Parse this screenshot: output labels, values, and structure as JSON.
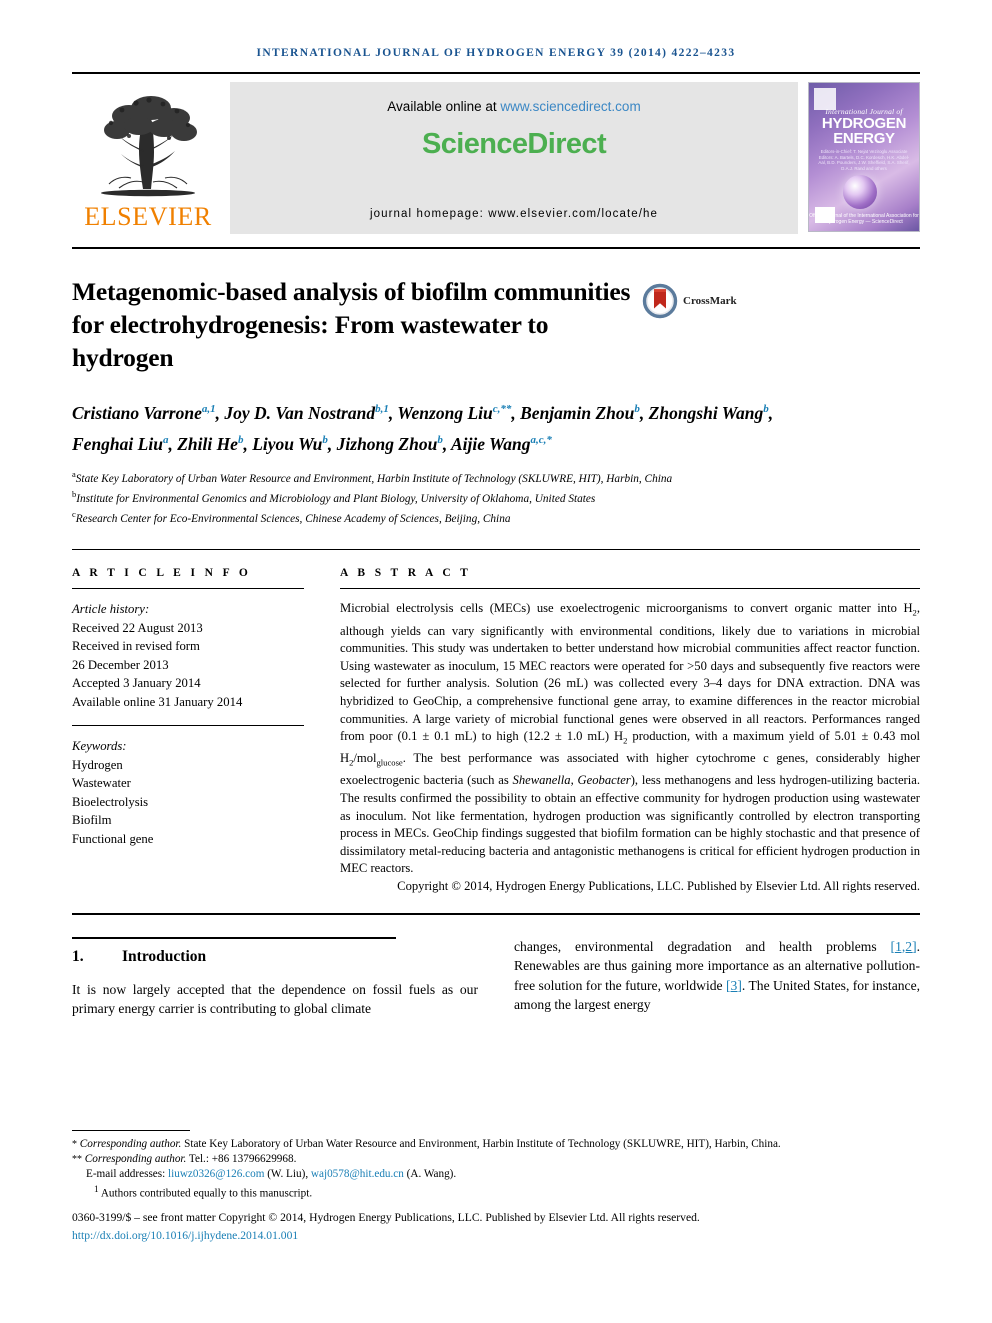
{
  "running_head": "INTERNATIONAL JOURNAL OF HYDROGEN ENERGY 39 (2014) 4222–4233",
  "masthead": {
    "publisher_name": "ELSEVIER",
    "available_prefix": "Available online at ",
    "available_url": "www.sciencedirect.com",
    "sciencedirect_part1": "Science",
    "sciencedirect_part2": "Direct",
    "journal_homepage": "journal homepage: www.elsevier.com/locate/he",
    "cover": {
      "line1": "International Journal of",
      "line2": "HYDROGEN",
      "line3": "ENERGY",
      "editors": "Editors-in-Chief: T. Nejat Veziroglu\nAssociate Editors: A. Bartels, D.C. Kordesch, H.K. Abdel-Aal,\nB.D. Pounders, J.W. Sheffield, S.A. Sherif, D.A.J. Rand and others",
      "footer": "Official Journal of the International Association for Hydrogen Energy — ScienceDirect"
    }
  },
  "article": {
    "title": "Metagenomic-based analysis of biofilm communities for electrohydrogenesis: From wastewater to hydrogen",
    "crossmark_label": "CrossMark",
    "authors": [
      {
        "name": "Cristiano Varrone",
        "sup": "a,1",
        "sep": ", "
      },
      {
        "name": "Joy D. Van Nostrand",
        "sup": "b,1",
        "sep": ", "
      },
      {
        "name": "Wenzong Liu",
        "sup": "c,**",
        "sep": ", "
      },
      {
        "name": "Benjamin Zhou",
        "sup": "b",
        "sep": ", "
      },
      {
        "name": "Zhongshi Wang",
        "sup": "b",
        "sep": ", "
      },
      {
        "name": "Fenghai Liu",
        "sup": "a",
        "sep": ", "
      },
      {
        "name": "Zhili He",
        "sup": "b",
        "sep": ", "
      },
      {
        "name": "Liyou Wu",
        "sup": "b",
        "sep": ", "
      },
      {
        "name": "Jizhong Zhou",
        "sup": "b",
        "sep": ", "
      },
      {
        "name": "Aijie Wang",
        "sup": "a,c,*",
        "sep": ""
      }
    ],
    "affiliations": [
      {
        "mark": "a",
        "text": "State Key Laboratory of Urban Water Resource and Environment, Harbin Institute of Technology (SKLUWRE, HIT), Harbin, China"
      },
      {
        "mark": "b",
        "text": "Institute for Environmental Genomics and Microbiology and Plant Biology, University of Oklahoma, United States"
      },
      {
        "mark": "c",
        "text": "Research Center for Eco-Environmental Sciences, Chinese Academy of Sciences, Beijing, China"
      }
    ]
  },
  "article_info": {
    "heading": "A R T I C L E   I N F O",
    "history_label": "Article history:",
    "history": [
      "Received 22 August 2013",
      "Received in revised form",
      "26 December 2013",
      "Accepted 3 January 2014",
      "Available online 31 January 2014"
    ],
    "keywords_label": "Keywords:",
    "keywords": [
      "Hydrogen",
      "Wastewater",
      "Bioelectrolysis",
      "Biofilm",
      "Functional gene"
    ]
  },
  "abstract": {
    "heading": "A B S T R A C T",
    "part1": "Microbial electrolysis cells (MECs) use exoelectrogenic microorganisms to convert organic matter into H",
    "sub1": "2",
    "part2": ", although yields can vary significantly with environmental conditions, likely due to variations in microbial communities. This study was undertaken to better understand how microbial communities affect reactor function. Using wastewater as inoculum, 15 MEC reactors were operated for >50 days and subsequently five reactors were selected for further analysis. Solution (26 mL) was collected every 3–4 days for DNA extraction. DNA was hybridized to GeoChip, a comprehensive functional gene array, to examine differences in the reactor microbial communities. A large variety of microbial functional genes were observed in all reactors. Performances ranged from poor (0.1 ± 0.1 mL) to high (12.2 ± 1.0 mL) H",
    "sub2": "2",
    "part3": " production, with a maximum yield of 5.01 ± 0.43 mol H",
    "sub3": "2",
    "part4": "/mol",
    "sub4": "glucose",
    "part5": ". The best performance was associated with higher cytochrome c genes, considerably higher exoelectrogenic bacteria (such as ",
    "italic1": "Shewanella, Geobacter",
    "part6": "), less methanogens and less hydrogen-utilizing bacteria. The results confirmed the possibility to obtain an effective community for hydrogen production using wastewater as inoculum. Not like fermentation, hydrogen production was significantly controlled by electron transporting process in MECs. GeoChip findings suggested that biofilm formation can be highly stochastic and that presence of dissimilatory metal-reducing bacteria and antagonistic methanogens is critical for efficient hydrogen production in MEC reactors.",
    "copyright": "Copyright © 2014, Hydrogen Energy Publications, LLC. Published by Elsevier Ltd. All rights reserved."
  },
  "introduction": {
    "number": "1.",
    "heading": "Introduction",
    "left_text": "It is now largely accepted that the dependence on fossil fuels as our primary energy carrier is contributing to global climate",
    "right_part1": "changes, environmental degradation and health problems ",
    "right_cite1": "[1,2]",
    "right_part2": ". Renewables are thus gaining more importance as an alternative pollution-free solution for the future, worldwide ",
    "right_cite2": "[3]",
    "right_part3": ". The United States, for instance, among the largest energy"
  },
  "footnotes": {
    "corresponding1_mark": "*",
    "corresponding1_label": "Corresponding author.",
    "corresponding1_text": " State Key Laboratory of Urban Water Resource and Environment, Harbin Institute of Technology (SKLUWRE, HIT), Harbin, China.",
    "corresponding2_mark": "**",
    "corresponding2_label": "Corresponding author.",
    "corresponding2_text": " Tel.: +86 13796629968.",
    "email_label": "E-mail addresses: ",
    "email1": "liuwz0326@126.com",
    "email1_attrib": " (W. Liu), ",
    "email2": "waj0578@hit.edu.cn",
    "email2_attrib": " (A. Wang).",
    "equal_mark": "1",
    "equal_text": " Authors contributed equally to this manuscript.",
    "issn_line": "0360-3199/$ – see front matter Copyright © 2014, Hydrogen Energy Publications, LLC. Published by Elsevier Ltd. All rights reserved.",
    "doi": "http://dx.doi.org/10.1016/j.ijhydene.2014.01.001"
  },
  "colors": {
    "link_blue": "#1a7fb5",
    "header_blue": "#1a5490",
    "elsevier_orange": "#f08000",
    "sciencedirect_green": "#4caf50"
  }
}
